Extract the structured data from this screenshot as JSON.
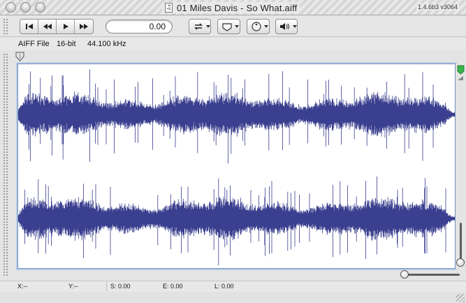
{
  "window": {
    "title": "01 Miles Davis - So What.aiff",
    "version": "1.4.6b3 v3064",
    "doc_icon_glyph": "♫"
  },
  "toolbar": {
    "transport": [
      {
        "name": "skip-to-start-icon",
        "glyph": "⏮"
      },
      {
        "name": "rewind-icon",
        "glyph": "⏪"
      },
      {
        "name": "play-icon",
        "glyph": "▶"
      },
      {
        "name": "fast-forward-icon",
        "glyph": "⏩"
      }
    ],
    "time_value": "0.00",
    "loop_icon": "loop-icon",
    "marker_icon": "marker-icon",
    "knob_icon": "knob-icon",
    "volume_icon": "volume-icon"
  },
  "info": {
    "format": "AIFF File",
    "bit_depth": "16-bit",
    "sample_rate": "44.100 kHz"
  },
  "status": {
    "x": "X:--",
    "y": "Y:--",
    "s": "S: 0.00",
    "e": "E: 0.00",
    "l": "L: 0.00"
  },
  "colors": {
    "waveform": "#3a3f8f",
    "marker_green": "#39b54a",
    "selection_border": "#6f8fb8"
  }
}
